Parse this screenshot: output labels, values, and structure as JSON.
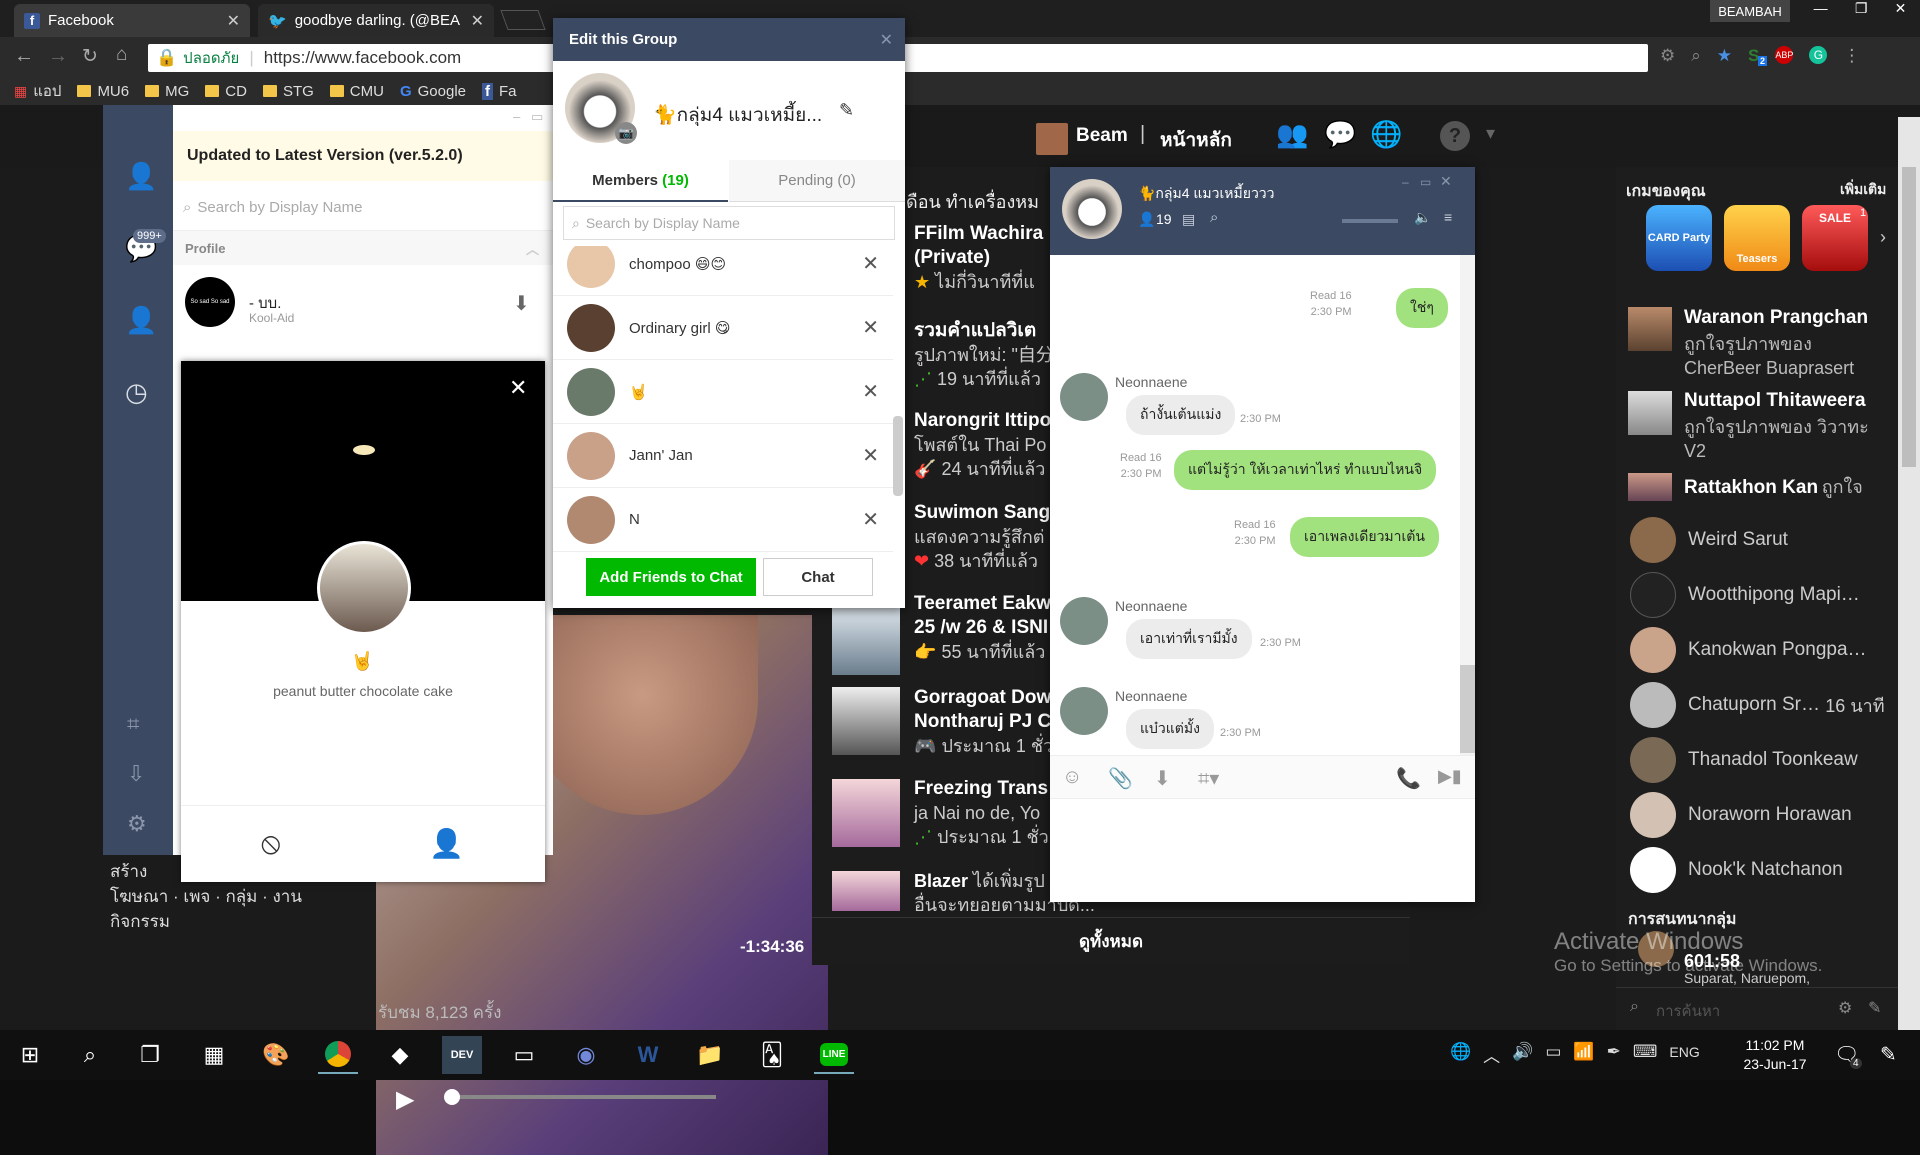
{
  "browser": {
    "tabs": [
      {
        "label": "Facebook"
      },
      {
        "label": "goodbye darling. (@BEA"
      }
    ],
    "user_badge": "BEAMBAH",
    "secure_label": "ปลอดภัย",
    "url": "https://www.facebook.com",
    "bookmarks": [
      {
        "label": "แอป"
      },
      {
        "label": "MU6"
      },
      {
        "label": "MG"
      },
      {
        "label": "CD"
      },
      {
        "label": "STG"
      },
      {
        "label": "CMU"
      },
      {
        "label": "Google"
      },
      {
        "label": "Fa"
      }
    ],
    "ext_badge": "2"
  },
  "facebook": {
    "user_name": "Beam",
    "home_label": "หน้าหลัก",
    "feed_header": "ดือน ทำเครื่องหม",
    "feed": [
      {
        "title": "FFilm Wachira",
        "title2": "(Private)",
        "sub": "ไม่กี่วินาทีที่แ"
      },
      {
        "title": "รวมคำแปลวิเต",
        "title2": "",
        "sub": "รูปภาพใหม่: \"自分",
        "sub2": "19 นาทีที่แล้ว"
      },
      {
        "title": "Narongrit Ittipo",
        "title2": "",
        "sub": "โพสต์ใน Thai Po",
        "sub2": "24 นาทีที่แล้ว"
      },
      {
        "title": "Suwimon Sang",
        "title2": "",
        "sub": "แสดงความรู้สึกต่",
        "sub2": "38 นาทีที่แล้ว"
      },
      {
        "title": "Teeramet Eakw",
        "title2": "25 /w 26 & ISNI",
        "sub": "55 นาทีที่แล้ว"
      },
      {
        "title": "Gorragoat Dow",
        "title2": "Nontharuj PJ C",
        "sub": "ประมาณ 1 ชั่ว"
      },
      {
        "title": "Freezing Trans",
        "title2": "",
        "sub": "ja Nai no de, Yo",
        "sub2": "ประมาณ 1 ชั่ว"
      },
      {
        "title": "Blazer",
        "title2": "",
        "sub": "ได้เพิ่มรูป",
        "sub2": "อื่นจะทยอยตามมาปัด...\""
      }
    ],
    "see_all": "ดูทั้งหมด",
    "video_time": "-1:34:36",
    "views": "รับชม 8,123 ครั้ง",
    "left_links": {
      "create": "สร้าง",
      "row1": "โฆษณา · เพจ · กลุ่ม · งาน",
      "row2": "กิจกรรม"
    },
    "right": {
      "games_title": "เกมของคุณ",
      "games_more": "เพิ่มเติม",
      "games": [
        {
          "label": "CARD Party"
        },
        {
          "label": "Teasers"
        },
        {
          "label": "SALE"
        }
      ],
      "game_badge": "1",
      "ticker": [
        {
          "name": "Waranon Prangchan",
          "sub": "ถูกใจรูปภาพของ",
          "sub2": "CherBeer Buaprasert"
        },
        {
          "name": "Nuttapol Thitaweera",
          "sub": "ถูกใจรูปภาพของ วิวาทะ",
          "sub2": "V2"
        },
        {
          "name": "Rattakhon Kan",
          "sub": "ถูกใจ"
        }
      ],
      "online": [
        {
          "name": "Weird Sarut",
          "extra": ""
        },
        {
          "name": "Wootthipong Mapi…",
          "extra": ""
        },
        {
          "name": "Kanokwan Pongpa…",
          "extra": ""
        },
        {
          "name": "Chatuporn Sr…",
          "extra": "16 นาที"
        },
        {
          "name": "Thanadol Toonkeaw",
          "extra": ""
        },
        {
          "name": "Noraworn Horawan",
          "extra": ""
        },
        {
          "name": "Nook'k Natchanon",
          "extra": ""
        }
      ],
      "groups_title": "การสนทนากลุ่ม",
      "group_num": "601:58",
      "group_sub": "Suparat, Naruepom,",
      "search_placeholder": "การค้นหา"
    }
  },
  "line": {
    "unread_badge": "999+",
    "update_banner": "Updated to Latest Version (ver.5.2.0)",
    "search_placeholder": "Search by Display Name",
    "section_profile": "Profile",
    "profile": {
      "name": "- บบ.",
      "status": "Kool-Aid",
      "avatar_text": "So sad So sad"
    },
    "popup": {
      "emoji": "🤘",
      "status": "peanut butter chocolate cake"
    }
  },
  "edit_group": {
    "title": "Edit this Group",
    "group_name": "🐈กลุ่ม4 แมวเหมี้ย...",
    "tab_members": "Members",
    "members_count": "(19)",
    "tab_pending": "Pending (0)",
    "search_placeholder": "Search by Display Name",
    "members": [
      {
        "name": "chompoo 😄😊"
      },
      {
        "name": "Ordinary girl 😋"
      },
      {
        "name": "🤘"
      },
      {
        "name": "Jann' Jan"
      },
      {
        "name": "N"
      }
    ],
    "add_button": "Add Friends to Chat",
    "chat_button": "Chat"
  },
  "chat": {
    "title": "🐈กลุ่ม4 แมวเหมี้ยววว",
    "member_count": "19",
    "messages": [
      {
        "from": "me",
        "text": "ใช่ๆ",
        "read": "Read 16",
        "time": "2:30 PM"
      },
      {
        "from": "Neonnaene",
        "text": "ถ้างั้นเต้นแม่ง",
        "time": "2:30 PM"
      },
      {
        "from": "me",
        "text": "แต่ไม่รู้ว่า ให้เวลาเท่าไหร่ ทำแบบไหนจิ",
        "read": "Read 16",
        "time": "2:30 PM"
      },
      {
        "from": "me",
        "text": "เอาเพลงเดียวมาเต้น",
        "read": "Read 16",
        "time": "2:30 PM"
      },
      {
        "from": "Neonnaene",
        "text": "เอาเท่าที่เรามีมั้ง",
        "time": "2:30 PM"
      },
      {
        "from": "Neonnaene",
        "text": "แบ๋วแต่มั้ง",
        "time": "2:30 PM"
      }
    ]
  },
  "windows": {
    "watermark_title": "Activate Windows",
    "watermark_sub": "Go to Settings to activate Windows.",
    "lang": "ENG",
    "time": "11:02 PM",
    "date": "23-Jun-17",
    "notif_count": "4"
  }
}
